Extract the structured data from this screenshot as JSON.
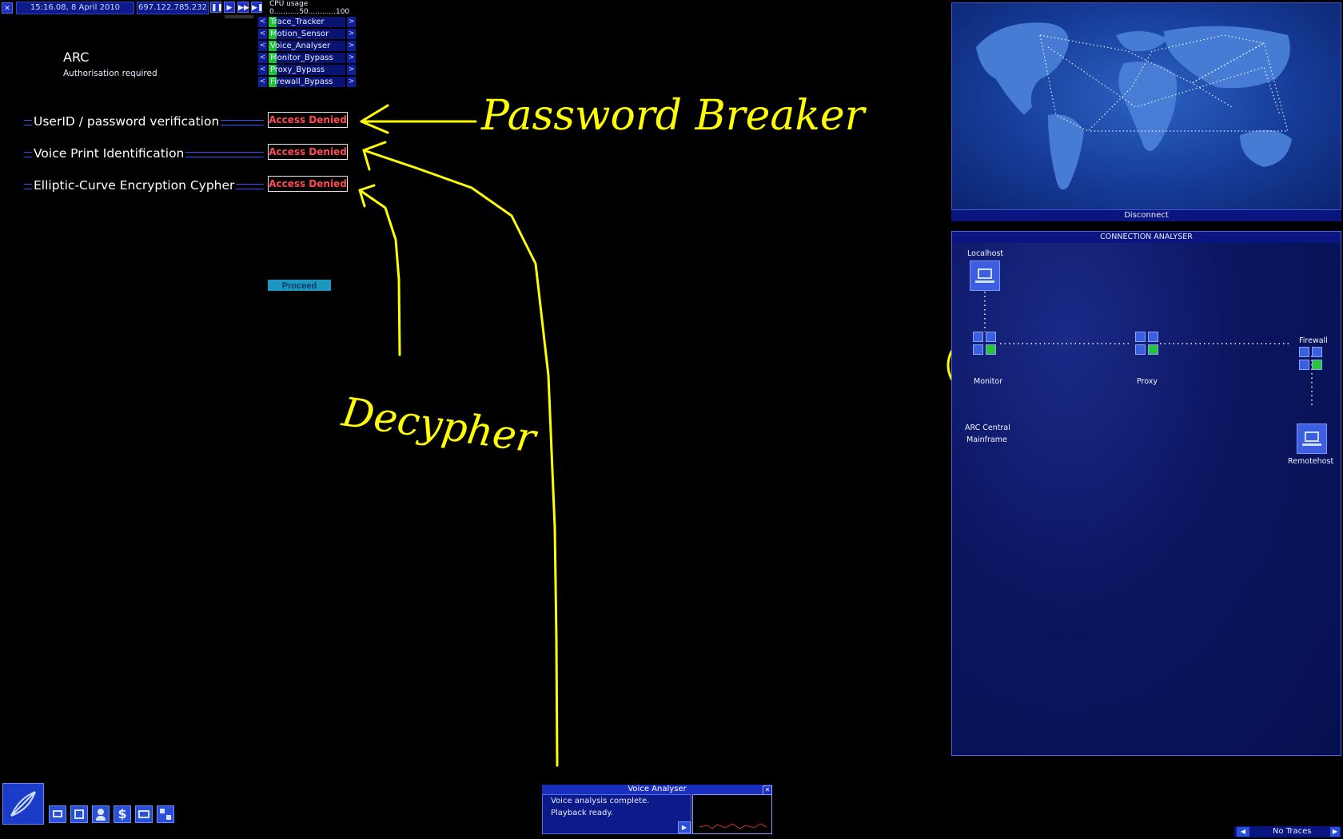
{
  "topbar": {
    "clock": "15:16.08, 8 April 2010",
    "ip": "697.122.785.232",
    "buttons": [
      "pause",
      "play",
      "fast-forward",
      "skip"
    ]
  },
  "cpu": {
    "label": "CPU usage",
    "scale": "0...........50............100"
  },
  "software": [
    {
      "name": "Trace_Tracker"
    },
    {
      "name": "Motion_Sensor"
    },
    {
      "name": "Voice_Analyser"
    },
    {
      "name": "Monitor_Bypass"
    },
    {
      "name": "Proxy_Bypass"
    },
    {
      "name": "Firewall_Bypass"
    }
  ],
  "main": {
    "title": "ARC",
    "subtitle": "Authorisation required",
    "security": [
      {
        "label": "UserID / password verification",
        "status": "Access Denied"
      },
      {
        "label": "Voice Print Identification",
        "status": "Access Denied"
      },
      {
        "label": "Elliptic-Curve Encryption Cypher",
        "status": "Access Denied"
      }
    ],
    "proceed_label": "Proceed"
  },
  "annotations": {
    "password_breaker": "Password Breaker",
    "decypher": "Decypher"
  },
  "worldmap": {
    "disconnect_label": "Disconnect"
  },
  "connection_analyser": {
    "title": "CONNECTION ANALYSER",
    "nodes": {
      "localhost": "Localhost",
      "monitor": "Monitor",
      "proxy": "Proxy",
      "firewall": "Firewall",
      "remotehost": "Remotehost",
      "target_line1": "ARC Central",
      "target_line2": "Mainframe"
    }
  },
  "taskbar": {
    "icons": [
      "monitor-icon",
      "disk-icon",
      "people-icon",
      "dollar-icon",
      "mail-icon",
      "network-icon"
    ]
  },
  "voice_analyser": {
    "title": "Voice Analyser",
    "line1": "Voice analysis complete.",
    "line2": "Playback ready."
  },
  "traces": {
    "label": "No Traces"
  },
  "colors": {
    "accent": "#1a2fb8",
    "denied": "#ff4b4b",
    "proceed": "#1b97c0",
    "annotation": "#ffff00",
    "cpu_fill": "#1ec33a"
  }
}
